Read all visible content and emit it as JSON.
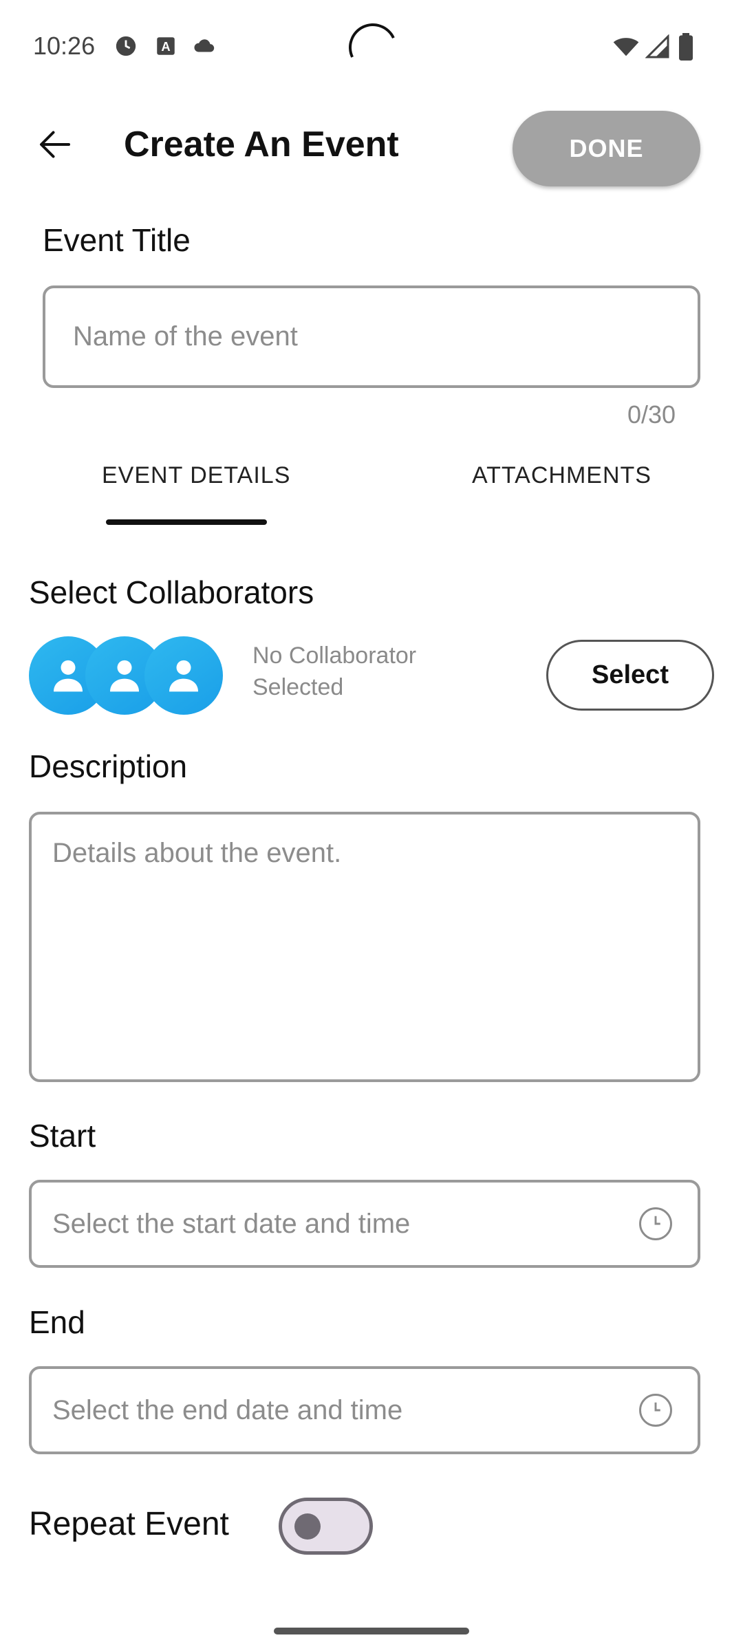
{
  "status_bar": {
    "time": "10:26",
    "icons": [
      "clock-icon",
      "keyboard-a-icon",
      "cloud-icon",
      "wifi-icon",
      "signal-icon",
      "battery-icon"
    ]
  },
  "header": {
    "title": "Create An Event",
    "done_label": "DONE",
    "back_icon": "arrow-left-icon"
  },
  "event_title": {
    "label": "Event Title",
    "placeholder": "Name of the event",
    "counter": "0/30"
  },
  "tabs": [
    {
      "label": "EVENT DETAILS",
      "selected": true
    },
    {
      "label": "ATTACHMENTS",
      "selected": false
    }
  ],
  "collaborators": {
    "label": "Select Collaborators",
    "status_line1": "No Collaborator",
    "status_line2": "Selected",
    "select_label": "Select",
    "avatar_icon": "user-icon"
  },
  "description": {
    "label": "Description",
    "placeholder": "Details about the event."
  },
  "start": {
    "label": "Start",
    "placeholder": "Select the start date and time"
  },
  "end": {
    "label": "End",
    "placeholder": "Select the end date and time"
  },
  "repeat": {
    "label": "Repeat Event",
    "enabled": false
  },
  "colors": {
    "accent_blue": "#1fa9ec",
    "done_disabled": "#a3a3a3",
    "border_gray": "#9a9a9a",
    "placeholder_gray": "#8c8c8c"
  }
}
